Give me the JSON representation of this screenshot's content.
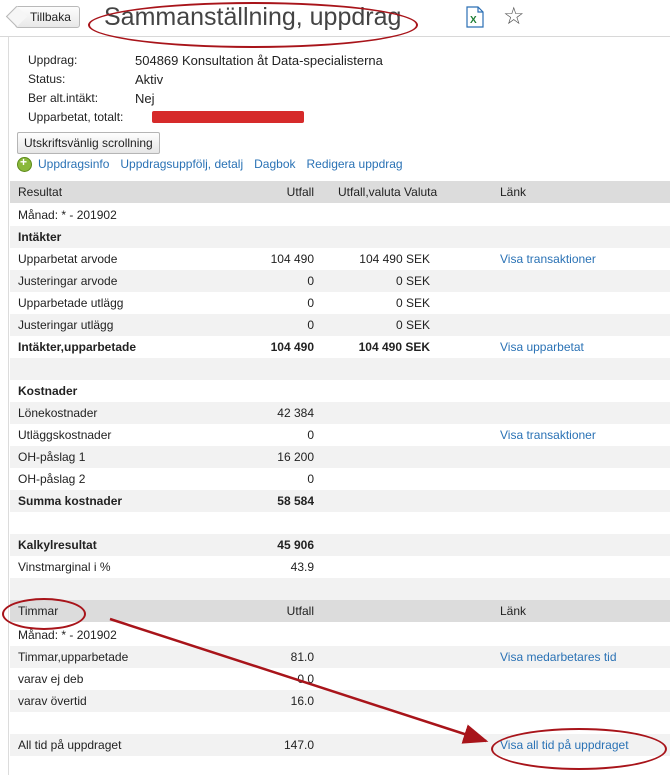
{
  "header": {
    "back_label": "Tillbaka",
    "title": "Sammanställning, uppdrag",
    "export_icon": "excel-icon",
    "favorite_icon": "star-icon"
  },
  "info": [
    {
      "label": "Uppdrag:",
      "value": "504869 Konsultation åt Data-specialisterna"
    },
    {
      "label": "Status:",
      "value": "Aktiv"
    },
    {
      "label": "Ber alt.intäkt:",
      "value": "Nej"
    },
    {
      "label": "Upparbetat, totalt:",
      "value": ""
    }
  ],
  "print_button": "Utskriftsvänlig scrollning",
  "nav_links": [
    "Uppdragsinfo",
    "Uppdragsuppfölj, detalj",
    "Dagbok",
    "Redigera uppdrag"
  ],
  "resultat": {
    "headers": {
      "label": "Resultat",
      "utfall": "Utfall",
      "valuta": "Utfall,valuta Valuta",
      "link": "Länk"
    },
    "rows": [
      {
        "label": "Månad: * - 201902",
        "utfall": "",
        "valuta": "",
        "link": "",
        "bold": false
      },
      {
        "label": "Intäkter",
        "utfall": "",
        "valuta": "",
        "link": "",
        "bold": true
      },
      {
        "label": "Upparbetat arvode",
        "utfall": "104 490",
        "valuta": "104 490 SEK",
        "link": "Visa transaktioner",
        "bold": false
      },
      {
        "label": "Justeringar arvode",
        "utfall": "0",
        "valuta": "0 SEK",
        "link": "",
        "bold": false
      },
      {
        "label": "Upparbetade utlägg",
        "utfall": "0",
        "valuta": "0 SEK",
        "link": "",
        "bold": false
      },
      {
        "label": "Justeringar utlägg",
        "utfall": "0",
        "valuta": "0 SEK",
        "link": "",
        "bold": false
      },
      {
        "label": "Intäkter,upparbetade",
        "utfall": "104 490",
        "valuta": "104 490 SEK",
        "link": "Visa upparbetat",
        "bold": true
      },
      {
        "label": "",
        "utfall": "",
        "valuta": "",
        "link": "",
        "bold": false
      },
      {
        "label": "Kostnader",
        "utfall": "",
        "valuta": "",
        "link": "",
        "bold": true
      },
      {
        "label": "Lönekostnader",
        "utfall": "42 384",
        "valuta": "",
        "link": "",
        "bold": false
      },
      {
        "label": "Utläggskostnader",
        "utfall": "0",
        "valuta": "",
        "link": "Visa transaktioner",
        "bold": false
      },
      {
        "label": "OH-påslag 1",
        "utfall": "16 200",
        "valuta": "",
        "link": "",
        "bold": false
      },
      {
        "label": "OH-påslag 2",
        "utfall": "0",
        "valuta": "",
        "link": "",
        "bold": false
      },
      {
        "label": "Summa kostnader",
        "utfall": "58 584",
        "valuta": "",
        "link": "",
        "bold": true
      },
      {
        "label": "",
        "utfall": "",
        "valuta": "",
        "link": "",
        "bold": false
      },
      {
        "label": "Kalkylresultat",
        "utfall": "45 906",
        "valuta": "",
        "link": "",
        "bold": true
      },
      {
        "label": "Vinstmarginal i %",
        "utfall": "43.9",
        "valuta": "",
        "link": "",
        "bold": false
      },
      {
        "label": "",
        "utfall": "",
        "valuta": "",
        "link": "",
        "bold": false
      }
    ]
  },
  "timmar": {
    "headers": {
      "label": "Timmar",
      "utfall": "Utfall",
      "link": "Länk"
    },
    "rows": [
      {
        "label": "Månad: * - 201902",
        "utfall": "",
        "link": "",
        "bold": false
      },
      {
        "label": "Timmar,upparbetade",
        "utfall": "81.0",
        "link": "Visa medarbetares tid",
        "bold": false
      },
      {
        "label": "varav ej deb",
        "utfall": "0.0",
        "link": "",
        "bold": false
      },
      {
        "label": "varav övertid",
        "utfall": "16.0",
        "link": "",
        "bold": false
      },
      {
        "label": "",
        "utfall": "",
        "link": "",
        "bold": false
      },
      {
        "label": "All tid på uppdraget",
        "utfall": "147.0",
        "link": "Visa all tid på uppdraget",
        "bold": false
      }
    ]
  },
  "colors": {
    "link": "#2a72b5",
    "annotation": "#a8141a",
    "redacted": "#d62a2a",
    "header_bg": "#dcdcdc"
  }
}
